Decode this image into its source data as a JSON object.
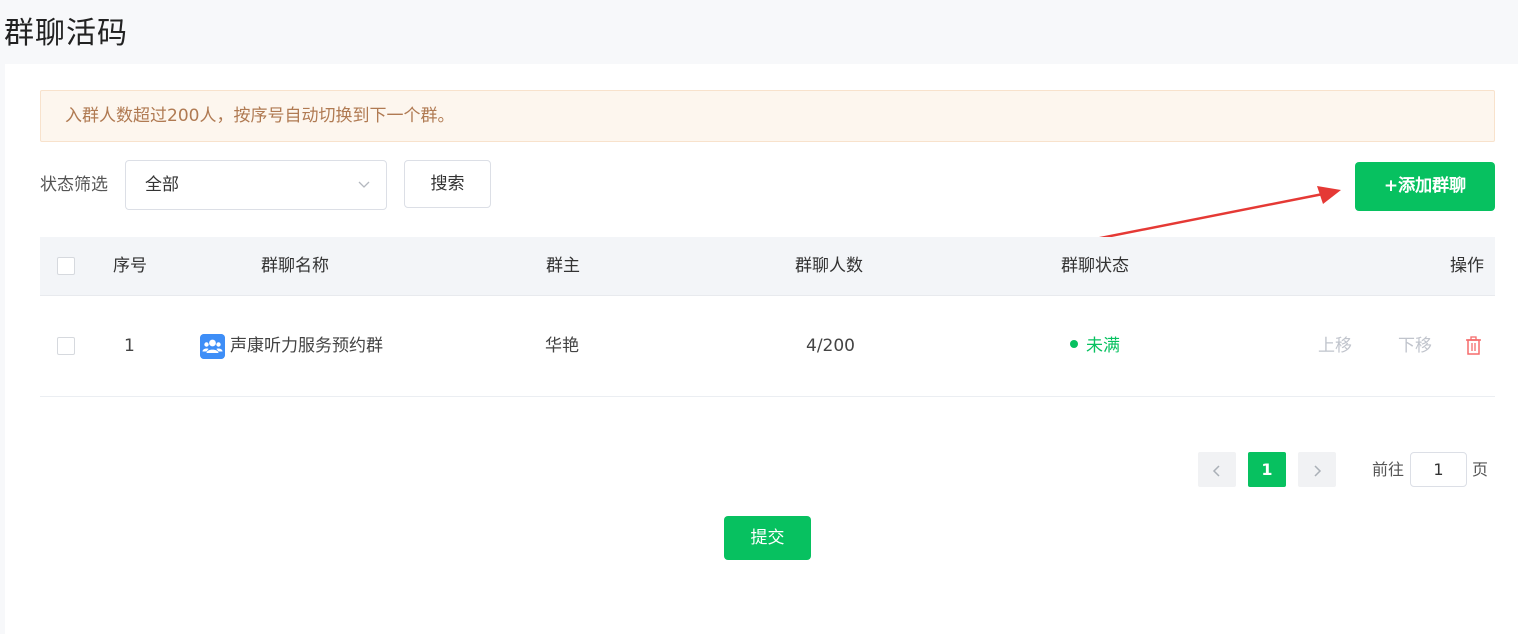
{
  "page": {
    "title": "群聊活码"
  },
  "notice": {
    "text": "入群人数超过200人，按序号自动切换到下一个群。"
  },
  "filter": {
    "label": "状态筛选",
    "selected": "全部",
    "search_label": "搜索"
  },
  "toolbar": {
    "add_label": "+添加群聊"
  },
  "table": {
    "headers": {
      "index": "序号",
      "name": "群聊名称",
      "owner": "群主",
      "members": "群聊人数",
      "status": "群聊状态",
      "actions": "操作"
    },
    "rows": [
      {
        "index": "1",
        "name": "声康听力服务预约群",
        "owner": "华艳",
        "members": "4/200",
        "status": "未满",
        "move_up": "上移",
        "move_down": "下移"
      }
    ]
  },
  "pagination": {
    "current_page": "1",
    "goto_prefix": "前往",
    "goto_value": "1",
    "goto_suffix": "页"
  },
  "submit": {
    "label": "提交"
  },
  "colors": {
    "accent": "#07c160",
    "annotation_arrow": "#e53935",
    "danger": "#f56c6c",
    "notice_text": "#b07a52"
  },
  "icons": {
    "select_chevron": "chevron-down-icon",
    "group": "group-users-icon",
    "delete": "trash-icon",
    "prev": "chevron-left-icon",
    "next": "chevron-right-icon"
  }
}
